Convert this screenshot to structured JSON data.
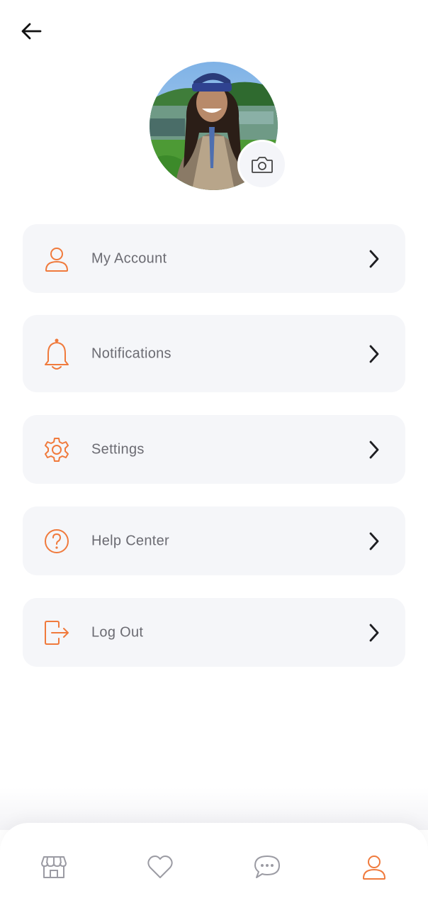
{
  "header": {
    "back_icon": "arrow-left-icon"
  },
  "profile": {
    "avatar_icon": "profile-photo",
    "camera_icon": "camera-icon"
  },
  "menu": {
    "items": [
      {
        "label": "My Account",
        "icon": "user-icon"
      },
      {
        "label": "Notifications",
        "icon": "bell-icon"
      },
      {
        "label": "Settings",
        "icon": "gear-icon"
      },
      {
        "label": "Help Center",
        "icon": "question-icon"
      },
      {
        "label": "Log Out",
        "icon": "logout-icon"
      }
    ]
  },
  "bottom_nav": {
    "items": [
      {
        "icon": "store-icon",
        "active": false
      },
      {
        "icon": "heart-icon",
        "active": false
      },
      {
        "icon": "chat-icon",
        "active": false
      },
      {
        "icon": "user-icon",
        "active": true
      }
    ]
  },
  "colors": {
    "accent": "#f07a3c",
    "card_bg": "#f5f6f9",
    "label": "#6b6b72",
    "icon_inactive": "#9b9ba3"
  }
}
